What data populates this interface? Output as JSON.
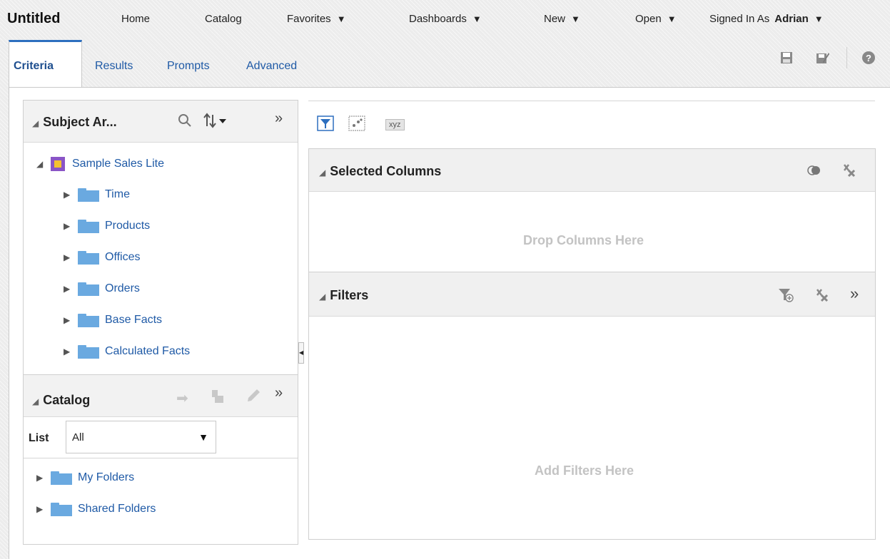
{
  "app": {
    "title": "Untitled"
  },
  "nav": {
    "home": "Home",
    "catalog": "Catalog",
    "favorites": "Favorites",
    "dashboards": "Dashboards",
    "new": "New",
    "open": "Open",
    "signed_in_as": "Signed In As",
    "user": "Adrian"
  },
  "tabs": [
    {
      "label": "Criteria",
      "active": true
    },
    {
      "label": "Results"
    },
    {
      "label": "Prompts"
    },
    {
      "label": "Advanced"
    }
  ],
  "toolbar_icons": [
    "save-icon",
    "save-as-icon",
    "help-icon"
  ],
  "subject_area": {
    "title": "Subject Ar...",
    "root": "Sample Sales Lite",
    "folders": [
      "Time",
      "Products",
      "Offices",
      "Orders",
      "Base Facts",
      "Calculated Facts"
    ]
  },
  "catalog": {
    "title": "Catalog",
    "list_label": "List",
    "list_value": "All",
    "folders": [
      "My Folders",
      "Shared Folders"
    ]
  },
  "criteria_toolbar": {
    "xyz_label": "xyz"
  },
  "selected_columns": {
    "title": "Selected Columns",
    "placeholder": "Drop Columns Here"
  },
  "filters": {
    "title": "Filters",
    "placeholder": "Add Filters Here"
  },
  "colors": {
    "accent": "#2d6fbf",
    "link": "#1f5aa6",
    "folder": "#6aa9e0",
    "placeholder": "#c3c3c3"
  }
}
